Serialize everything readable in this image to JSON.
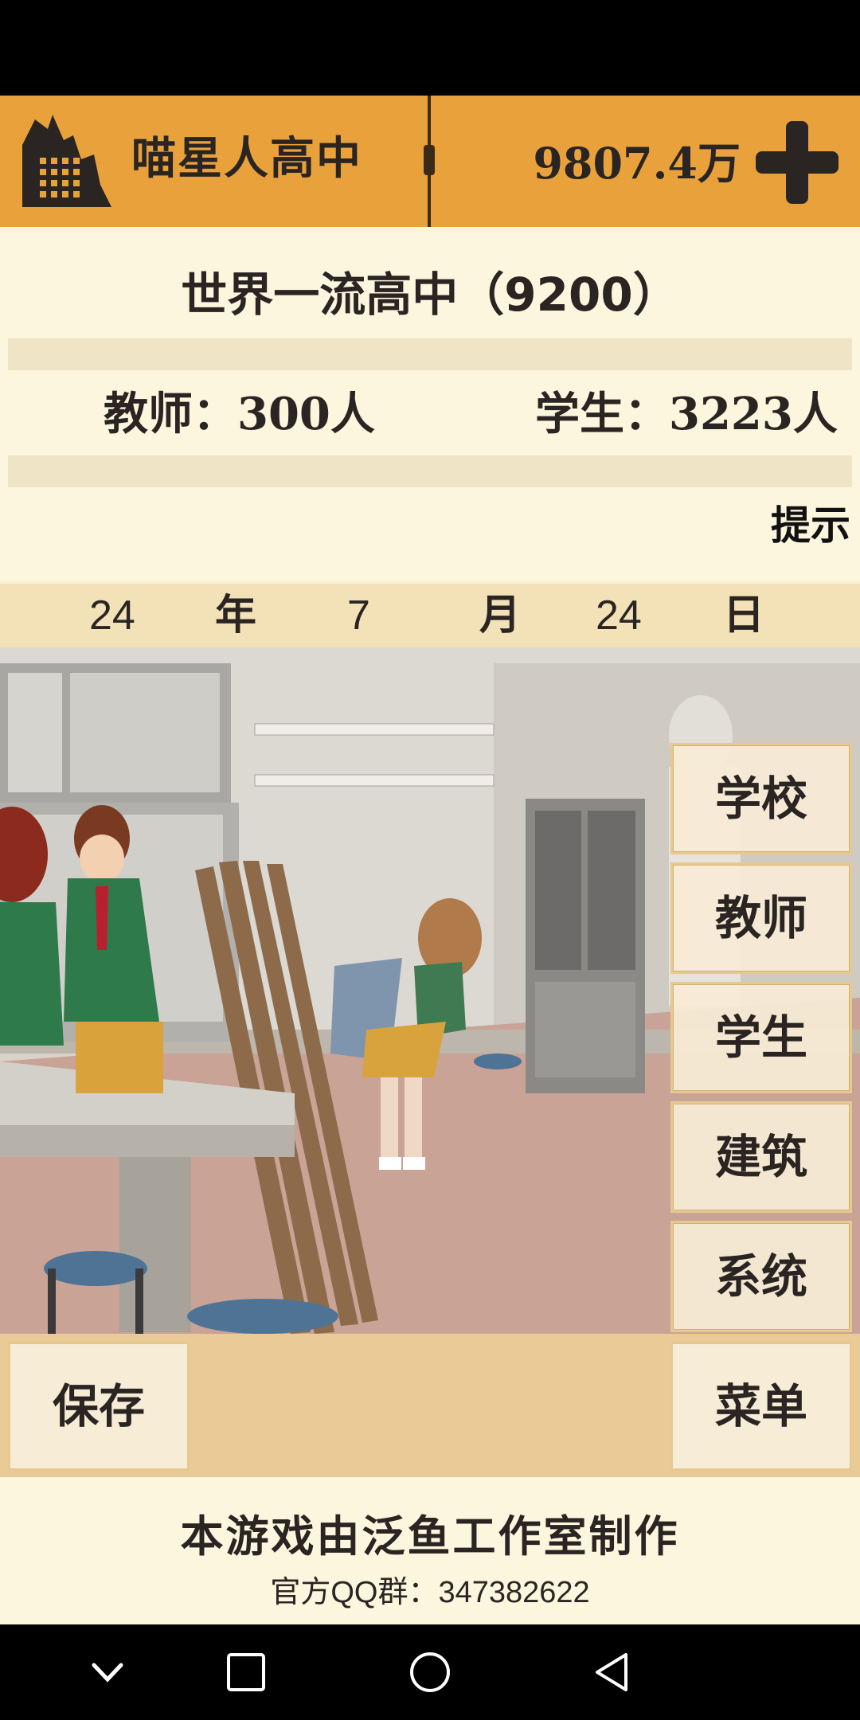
{
  "header": {
    "school_name": "喵星人高中",
    "money": "9807.4万",
    "add_icon": "plus-icon",
    "logo_icon": "factory-icon"
  },
  "info": {
    "rank": "世界一流高中（9200）",
    "teachers_label": "教师：",
    "teachers_value": "300人",
    "students_label": "学生：",
    "students_value": "3223人",
    "hint": "提示"
  },
  "date": {
    "year": "24",
    "year_label": "年",
    "month": "7",
    "month_label": "月",
    "day": "24",
    "day_label": "日"
  },
  "side_menu": [
    {
      "label": "学校"
    },
    {
      "label": "教师"
    },
    {
      "label": "学生"
    },
    {
      "label": "建筑"
    },
    {
      "label": "系统"
    }
  ],
  "actions": {
    "save": "保存",
    "menu": "菜单"
  },
  "credits": {
    "studio": "本游戏由泛鱼工作室制作",
    "qq": "官方QQ群：347382622"
  },
  "colors": {
    "header_orange": "#E9A23B",
    "panel_cream": "#FDF6DE",
    "button_bg": "#F7ECD6"
  }
}
